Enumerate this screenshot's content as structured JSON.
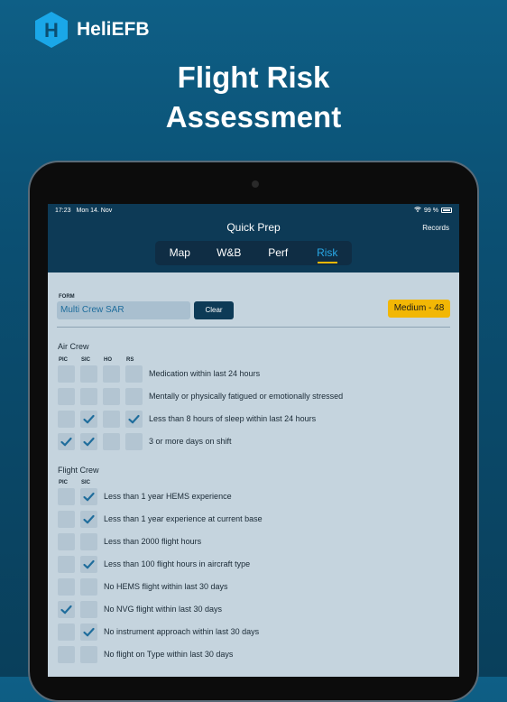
{
  "brand": {
    "name": "HeliEFB",
    "logo_letter": "H",
    "logo_icon": "hexagon-h-logo",
    "color": "#1aa7e8"
  },
  "headline": {
    "line1": "Flight Risk",
    "line2": "Assessment"
  },
  "status_bar": {
    "time": "17:23",
    "date": "Mon 14. Nov",
    "battery_pct": "99 %",
    "battery_level": 0.99
  },
  "nav": {
    "title": "Quick Prep",
    "records_label": "Records"
  },
  "tabs": [
    {
      "label": "Map",
      "active": false
    },
    {
      "label": "W&B",
      "active": false
    },
    {
      "label": "Perf",
      "active": false
    },
    {
      "label": "Risk",
      "active": true
    }
  ],
  "form": {
    "label": "FORM",
    "value": "Multi Crew SAR",
    "clear_label": "Clear",
    "risk_badge": "Medium - 48",
    "risk_color": "#f2b705"
  },
  "air_crew": {
    "title": "Air Crew",
    "columns": [
      "PIC",
      "SIC",
      "HO",
      "RS"
    ],
    "rows": [
      {
        "label": "Medication within last 24 hours",
        "checks": [
          false,
          false,
          false,
          false
        ]
      },
      {
        "label": "Mentally or physically fatigued or emotionally stressed",
        "checks": [
          false,
          false,
          false,
          false
        ]
      },
      {
        "label": "Less than 8 hours of sleep within last 24 hours",
        "checks": [
          false,
          true,
          false,
          true
        ]
      },
      {
        "label": "3 or more days on shift",
        "checks": [
          true,
          true,
          false,
          false
        ]
      }
    ]
  },
  "flight_crew": {
    "title": "Flight Crew",
    "columns": [
      "PIC",
      "SIC"
    ],
    "rows": [
      {
        "label": "Less than 1 year HEMS experience",
        "checks": [
          false,
          true
        ]
      },
      {
        "label": "Less than 1 year experience at current base",
        "checks": [
          false,
          true
        ]
      },
      {
        "label": "Less than 2000 flight hours",
        "checks": [
          false,
          false
        ]
      },
      {
        "label": "Less than 100 flight hours in aircraft type",
        "checks": [
          false,
          true
        ]
      },
      {
        "label": "No HEMS flight within last 30 days",
        "checks": [
          false,
          false
        ]
      },
      {
        "label": "No NVG flight within last 30 days",
        "checks": [
          true,
          false
        ]
      },
      {
        "label": "No instrument approach within last 30 days",
        "checks": [
          false,
          true
        ]
      },
      {
        "label": "No flight on Type within last 30 days",
        "checks": [
          false,
          false
        ]
      }
    ]
  },
  "colors": {
    "check": "#1f6d9c",
    "accent": "#29a8e6",
    "nav_bg": "#0d3a56",
    "screen_bg": "#c5d4de"
  }
}
